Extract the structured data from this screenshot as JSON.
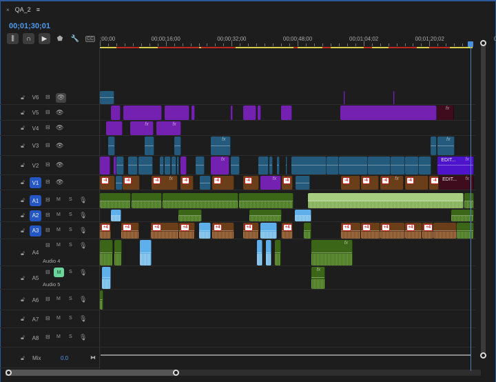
{
  "panel": {
    "close_icon": "×",
    "title": "QA_2",
    "menu_icon": "≡"
  },
  "timecode": "00;01;30;01",
  "toolbar": [
    {
      "name": "insert-sequence-nest-icon",
      "glyph": "⫼"
    },
    {
      "name": "snap-magnet-icon",
      "glyph": "∩"
    },
    {
      "name": "linked-selection-icon",
      "glyph": "▶"
    },
    {
      "name": "add-marker-icon",
      "glyph": "⬟"
    },
    {
      "name": "wrench-settings-icon",
      "glyph": "🔧"
    },
    {
      "name": "captions-icon",
      "glyph": "CC"
    }
  ],
  "ruler": {
    "labels": [
      {
        "text": ";00;00",
        "time_sec": 0
      },
      {
        "text": "00;00;16;00",
        "time_sec": 16
      },
      {
        "text": "00;00;32;00",
        "time_sec": 32
      },
      {
        "text": "00;00;48;00",
        "time_sec": 48
      },
      {
        "text": "00;01;04;02",
        "time_sec": 64.07
      },
      {
        "text": "00;01;20;02",
        "time_sec": 80.07
      },
      {
        "text": "0",
        "time_sec": 96
      }
    ],
    "render_bar": [
      [
        0,
        4,
        "#d8d048"
      ],
      [
        4,
        9.5,
        "#c02a1e"
      ],
      [
        9.5,
        14,
        "#d8d048"
      ],
      [
        14,
        24,
        "#c02a1e"
      ],
      [
        24,
        24.6,
        "#d8d048"
      ],
      [
        24.6,
        33,
        "#c02a1e"
      ],
      [
        33,
        47,
        "#d8d048"
      ],
      [
        47,
        48,
        "#c02a1e"
      ],
      [
        48,
        54,
        "#d8d048"
      ],
      [
        54,
        56,
        "#c02a1e"
      ],
      [
        56,
        64,
        "#d8d048"
      ],
      [
        64,
        66,
        "#c02a1e"
      ],
      [
        66,
        70,
        "#d8d048"
      ],
      [
        70,
        77,
        "#c02a1e"
      ],
      [
        77,
        80,
        "#d8d048"
      ],
      [
        80,
        85,
        "#c02a1e"
      ],
      [
        85,
        90.5,
        "#d8d048"
      ]
    ],
    "playhead_sec": 90.03
  },
  "colors": {
    "blue": "#245a7c",
    "purple": "#7420b0",
    "indigo": "#4e14cc",
    "brown": "#6a3e18",
    "darkred": "#3e0c1c",
    "green": "#3b6618",
    "lightgreen": "#a6cd80",
    "audioblue": "#5fb0ea",
    "accent": "#2457c4",
    "timecode": "#4c9bf0"
  },
  "tracks": [
    {
      "id": "V6",
      "type": "video",
      "eye_toggled": true,
      "clips": [
        [
          0,
          3.5,
          "blue"
        ],
        [
          59.2,
          59.5,
          "purple"
        ],
        [
          71.2,
          71.5,
          "purple"
        ]
      ]
    },
    {
      "id": "V5",
      "type": "video",
      "clips": [
        [
          2.7,
          5,
          "purple"
        ],
        [
          5.7,
          15,
          "purple"
        ],
        [
          15.7,
          21.7,
          "purple"
        ],
        [
          22.2,
          23,
          "purple"
        ],
        [
          31.8,
          32.3,
          "purple"
        ],
        [
          34.8,
          38,
          "purple"
        ],
        [
          38.3,
          39.2,
          "purple"
        ],
        [
          44,
          46.7,
          "purple"
        ],
        [
          58.3,
          81.7,
          "purple"
        ],
        [
          82,
          86,
          "darkred",
          null,
          null,
          true
        ]
      ]
    },
    {
      "id": "V4",
      "type": "video",
      "clips": [
        [
          1.5,
          5.5,
          "purple"
        ],
        [
          7.3,
          13,
          "purple",
          null,
          null,
          true
        ],
        [
          13.7,
          19.7,
          "purple",
          null,
          null,
          true
        ]
      ]
    },
    {
      "id": "V3",
      "type": "video",
      "clips": [
        [
          2,
          3.7,
          "blue"
        ],
        [
          10.8,
          13.2,
          "blue"
        ],
        [
          18,
          19.8,
          "blue"
        ],
        [
          27,
          31.7,
          "blue",
          null,
          null,
          true
        ],
        [
          80.2,
          81.8,
          "blue"
        ],
        [
          82,
          86.2,
          "blue",
          null,
          null,
          true
        ]
      ]
    },
    {
      "id": "V2",
      "type": "video",
      "clips": [
        [
          0,
          2.5,
          "purple"
        ],
        [
          3.3,
          4,
          "purple"
        ],
        [
          4,
          5.8,
          "blue"
        ],
        [
          6.8,
          9.2,
          "blue"
        ],
        [
          9.4,
          12.8,
          "blue"
        ],
        [
          14.5,
          15.5,
          "blue"
        ],
        [
          15.8,
          17.2,
          "blue"
        ],
        [
          17.4,
          18.5,
          "blue"
        ],
        [
          18.7,
          19.3,
          "blue"
        ],
        [
          19.5,
          21,
          "purple"
        ],
        [
          23.2,
          25.5,
          "blue"
        ],
        [
          27,
          31.5,
          "purple",
          null,
          null,
          true
        ],
        [
          31.7,
          34,
          "blue"
        ],
        [
          38.5,
          41,
          "blue"
        ],
        [
          41.2,
          42,
          "blue"
        ],
        [
          43,
          43.7,
          "blue"
        ],
        [
          45.2,
          45.5,
          "blue"
        ],
        [
          46.5,
          55,
          "blue"
        ],
        [
          55,
          58,
          "blue"
        ],
        [
          58,
          65,
          "blue"
        ],
        [
          65,
          70.5,
          "blue"
        ],
        [
          70.5,
          74,
          "blue"
        ],
        [
          74,
          77.5,
          "blue"
        ],
        [
          77.5,
          80.5,
          "blue"
        ],
        [
          82,
          90.8,
          "indigo",
          "EDIT...",
          null,
          true
        ]
      ]
    },
    {
      "id": "V1",
      "type": "video",
      "targeted": true,
      "clips": [
        [
          0,
          3.7,
          "brown",
          null,
          "-4"
        ],
        [
          3.8,
          5.5,
          "blue"
        ],
        [
          5.5,
          9.7,
          "brown",
          null,
          "-4"
        ],
        [
          12.5,
          18.9,
          "brown",
          null,
          "-4",
          true
        ],
        [
          19.5,
          22.7,
          "brown",
          null,
          "-4"
        ],
        [
          24.2,
          27,
          "blue"
        ],
        [
          27.2,
          32.6,
          "brown",
          null,
          "-4"
        ],
        [
          34.7,
          38.6,
          "brown",
          null,
          "-4"
        ],
        [
          39,
          44,
          "purple",
          null,
          null,
          true
        ],
        [
          44.1,
          46.8,
          "brown",
          null,
          "-4"
        ],
        [
          47.5,
          51,
          "blue"
        ],
        [
          58.5,
          63.2,
          "brown",
          null,
          "-4"
        ],
        [
          63.3,
          67.7,
          "brown",
          null,
          "-4"
        ],
        [
          68,
          73.7,
          "brown",
          null,
          "-4",
          true
        ],
        [
          74,
          79.8,
          "brown",
          null,
          "-4"
        ],
        [
          80,
          82.2,
          "brown",
          null,
          "-4"
        ],
        [
          82.3,
          90.8,
          "darkred",
          "EDIT...",
          null,
          true
        ]
      ]
    },
    {
      "id": "A1",
      "type": "audio",
      "targeted": true,
      "clips": [
        [
          0,
          7.5,
          "green"
        ],
        [
          7.7,
          15,
          "green"
        ],
        [
          15.2,
          33.6,
          "green"
        ],
        [
          33.8,
          47,
          "green"
        ],
        [
          50.5,
          88.3,
          "lightgreen"
        ],
        [
          88.5,
          90.8,
          "green"
        ]
      ]
    },
    {
      "id": "A2",
      "type": "audio",
      "targeted": true,
      "clips": [
        [
          2.7,
          5.2,
          "audioblue"
        ],
        [
          19,
          24.8,
          "green"
        ],
        [
          36.3,
          44.2,
          "green"
        ],
        [
          47.3,
          51.3,
          "audioblue"
        ],
        [
          85.3,
          90.8,
          "green"
        ]
      ]
    },
    {
      "id": "A3",
      "type": "audio",
      "targeted": true,
      "clips": [
        [
          0,
          2.7,
          "brown",
          null,
          "+4"
        ],
        [
          5.2,
          9.5,
          "brown",
          null,
          "+4"
        ],
        [
          12.4,
          19.2,
          "brown",
          null,
          "+4"
        ],
        [
          19.3,
          23,
          "brown",
          null,
          "+4"
        ],
        [
          24,
          26.9,
          "audioblue"
        ],
        [
          27.2,
          32.6,
          "brown",
          null,
          "+4"
        ],
        [
          34.7,
          38.6,
          "brown",
          null,
          "+4"
        ],
        [
          39,
          43,
          "audioblue"
        ],
        [
          44.1,
          46.8,
          "brown",
          null,
          "+4"
        ],
        [
          49.5,
          51.3,
          "green"
        ],
        [
          58.5,
          63.3,
          "brown",
          null,
          "+4"
        ],
        [
          63.3,
          68,
          "brown",
          null,
          "+4"
        ],
        [
          68,
          74,
          "brown",
          null,
          "+4"
        ],
        [
          74,
          78.3,
          "brown",
          null,
          "+4"
        ],
        [
          78.3,
          81,
          "brown",
          null,
          "+4"
        ],
        [
          81,
          86.6,
          "brown"
        ],
        [
          86.6,
          90.8,
          "green"
        ]
      ]
    },
    {
      "id": "A4",
      "type": "audio",
      "name": "Audio 4",
      "clips": [
        [
          0,
          3.2,
          "green"
        ],
        [
          3.5,
          5.3,
          "green"
        ],
        [
          9.7,
          12.5,
          "audioblue"
        ],
        [
          38.1,
          39.5,
          "audioblue"
        ],
        [
          40.3,
          41.6,
          "audioblue"
        ],
        [
          42.5,
          44,
          "green"
        ],
        [
          51.3,
          61.4,
          "green",
          null,
          null,
          true
        ]
      ]
    },
    {
      "id": "A5",
      "type": "audio",
      "name": "Audio 5",
      "muted": true,
      "clips": [
        [
          0.5,
          2.7,
          "audioblue"
        ],
        [
          51.3,
          54.7,
          "green",
          null,
          null,
          true
        ]
      ]
    },
    {
      "id": "A6",
      "type": "audio",
      "clips": [
        [
          0,
          0.8,
          "green"
        ]
      ]
    },
    {
      "id": "A7",
      "type": "audio",
      "clips": []
    },
    {
      "id": "A8",
      "type": "audio",
      "clips": []
    }
  ],
  "audio_buttons": {
    "mute": "M",
    "solo": "S"
  },
  "fx_label": "fx",
  "mix": {
    "label": "Mix",
    "value": "0.0"
  }
}
